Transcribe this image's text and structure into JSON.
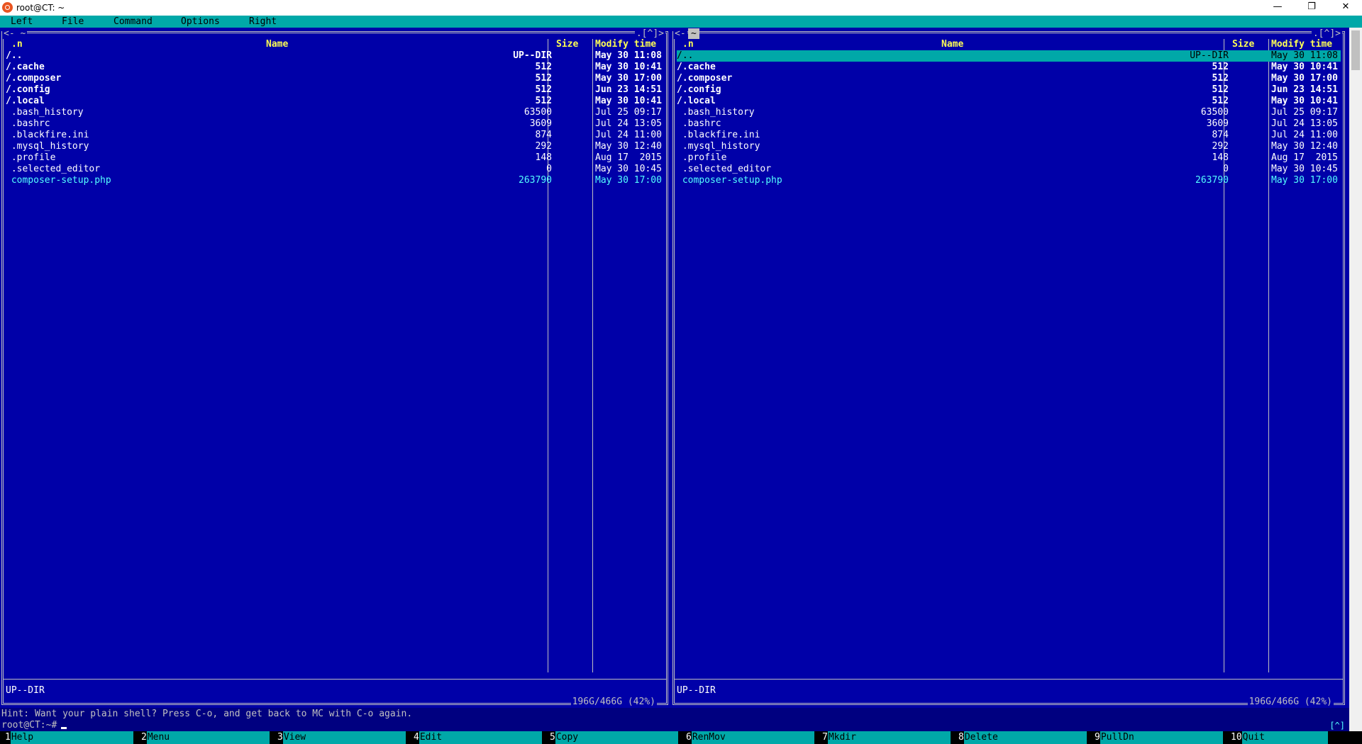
{
  "window": {
    "title": "root@CT: ~",
    "minimize": "—",
    "restore": "❐",
    "close": "✕"
  },
  "menu": [
    "Left",
    "File",
    "Command",
    "Options",
    "Right"
  ],
  "left_panel": {
    "corner_left": "<- ~",
    "corner_right": ".[^]>",
    "path": "",
    "headers": {
      "n": ".n",
      "name": "Name",
      "size": "Size",
      "modify": "Modify time"
    },
    "rows": [
      {
        "name": "/..",
        "size": "UP--DIR",
        "time": "May 30 11:08",
        "kind": "dir"
      },
      {
        "name": "/.cache",
        "size": "512",
        "time": "May 30 10:41",
        "kind": "dir"
      },
      {
        "name": "/.composer",
        "size": "512",
        "time": "May 30 17:00",
        "kind": "dir"
      },
      {
        "name": "/.config",
        "size": "512",
        "time": "Jun 23 14:51",
        "kind": "dir"
      },
      {
        "name": "/.local",
        "size": "512",
        "time": "May 30 10:41",
        "kind": "dir"
      },
      {
        "name": " .bash_history",
        "size": "63500",
        "time": "Jul 25 09:17",
        "kind": "file"
      },
      {
        "name": " .bashrc",
        "size": "3609",
        "time": "Jul 24 13:05",
        "kind": "file"
      },
      {
        "name": " .blackfire.ini",
        "size": "874",
        "time": "Jul 24 11:00",
        "kind": "file"
      },
      {
        "name": " .mysql_history",
        "size": "292",
        "time": "May 30 12:40",
        "kind": "file"
      },
      {
        "name": " .profile",
        "size": "148",
        "time": "Aug 17  2015",
        "kind": "file"
      },
      {
        "name": " .selected_editor",
        "size": "0",
        "time": "May 30 10:45",
        "kind": "file"
      },
      {
        "name": " composer-setup.php",
        "size": "263790",
        "time": "May 30 17:00",
        "kind": "exe"
      }
    ],
    "mini_status": "UP--DIR",
    "free_space": "196G/466G (42%)"
  },
  "right_panel": {
    "corner_left": "<-",
    "corner_right": ".[^]>",
    "path": "~",
    "headers": {
      "n": ".n",
      "name": "Name",
      "size": "Size",
      "modify": "Modify time"
    },
    "rows": [
      {
        "name": "/..",
        "size": "UP--DIR",
        "time": "May 30 11:08",
        "kind": "sel"
      },
      {
        "name": "/.cache",
        "size": "512",
        "time": "May 30 10:41",
        "kind": "dir"
      },
      {
        "name": "/.composer",
        "size": "512",
        "time": "May 30 17:00",
        "kind": "dir"
      },
      {
        "name": "/.config",
        "size": "512",
        "time": "Jun 23 14:51",
        "kind": "dir"
      },
      {
        "name": "/.local",
        "size": "512",
        "time": "May 30 10:41",
        "kind": "dir"
      },
      {
        "name": " .bash_history",
        "size": "63500",
        "time": "Jul 25 09:17",
        "kind": "file"
      },
      {
        "name": " .bashrc",
        "size": "3609",
        "time": "Jul 24 13:05",
        "kind": "file"
      },
      {
        "name": " .blackfire.ini",
        "size": "874",
        "time": "Jul 24 11:00",
        "kind": "file"
      },
      {
        "name": " .mysql_history",
        "size": "292",
        "time": "May 30 12:40",
        "kind": "file"
      },
      {
        "name": " .profile",
        "size": "148",
        "time": "Aug 17  2015",
        "kind": "file"
      },
      {
        "name": " .selected_editor",
        "size": "0",
        "time": "May 30 10:45",
        "kind": "file"
      },
      {
        "name": " composer-setup.php",
        "size": "263790",
        "time": "May 30 17:00",
        "kind": "exe"
      }
    ],
    "mini_status": "UP--DIR",
    "free_space": "196G/466G (42%)"
  },
  "hint": "Hint: Want your plain shell? Press C-o, and get back to MC with C-o again.",
  "prompt": "root@CT:~#",
  "scroll_indicator": "[^]",
  "fkeys": [
    {
      "num": "1",
      "label": "Help"
    },
    {
      "num": "2",
      "label": "Menu"
    },
    {
      "num": "3",
      "label": "View"
    },
    {
      "num": "4",
      "label": "Edit"
    },
    {
      "num": "5",
      "label": "Copy"
    },
    {
      "num": "6",
      "label": "RenMov"
    },
    {
      "num": "7",
      "label": "Mkdir"
    },
    {
      "num": "8",
      "label": "Delete"
    },
    {
      "num": "9",
      "label": "PullDn"
    },
    {
      "num": "10",
      "label": "Quit"
    }
  ]
}
